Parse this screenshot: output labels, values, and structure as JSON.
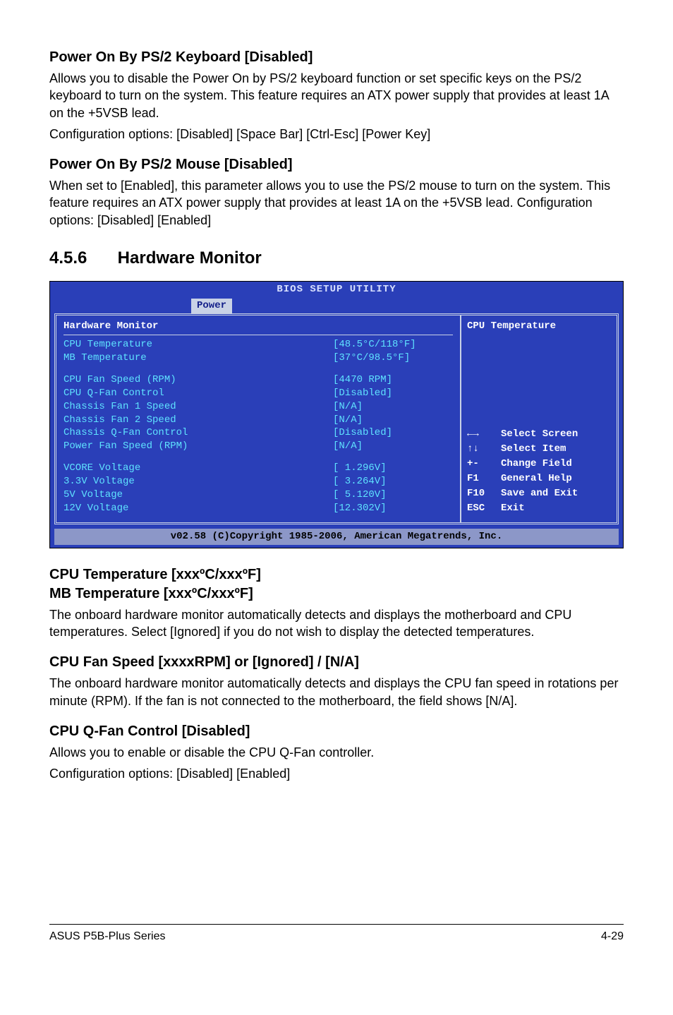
{
  "sections": {
    "kb_title": "Power On By PS/2 Keyboard [Disabled]",
    "kb_body1": "Allows you to disable the Power On by PS/2 keyboard function or set specific keys on the PS/2 keyboard to turn on the system. This feature requires an ATX power supply that provides at least 1A on the +5VSB lead.",
    "kb_body2": "Configuration options: [Disabled] [Space Bar] [Ctrl-Esc] [Power Key]",
    "mouse_title": "Power On By PS/2 Mouse [Disabled]",
    "mouse_body": "When set to [Enabled], this parameter allows you to use the PS/2 mouse to turn on the system. This feature requires an ATX power supply that provides at least 1A on the +5VSB lead. Configuration options: [Disabled] [Enabled]",
    "hw_num": "4.5.6",
    "hw_title": "Hardware Monitor",
    "temp_title": "CPU Temperature [xxxºC/xxxºF]\nMB Temperature [xxxºC/xxxºF]",
    "temp_body": "The onboard hardware monitor automatically detects and displays the motherboard and CPU temperatures. Select [Ignored] if you do not wish to display the detected temperatures.",
    "fan_title": "CPU Fan Speed [xxxxRPM] or [Ignored] / [N/A]",
    "fan_body": "The onboard hardware monitor automatically detects and displays the CPU fan speed in rotations per minute (RPM). If the fan is not connected to the motherboard, the field shows [N/A].",
    "qfan_title": "CPU Q-Fan Control [Disabled]",
    "qfan_body1": "Allows you to enable or disable the CPU Q-Fan controller.",
    "qfan_body2": "Configuration options: [Disabled] [Enabled]"
  },
  "bios": {
    "title": "BIOS SETUP UTILITY",
    "tab": "Power",
    "panel_title": "Hardware Monitor",
    "rows": [
      {
        "label": "CPU Temperature",
        "value": "[48.5°C/118°F]"
      },
      {
        "label": "MB Temperature",
        "value": "[37°C/98.5°F]"
      }
    ],
    "rows2": [
      {
        "label": "CPU Fan Speed (RPM)",
        "value": "[4470 RPM]"
      },
      {
        "label": "CPU Q-Fan Control",
        "value": "[Disabled]"
      },
      {
        "label": "Chassis Fan 1 Speed",
        "value": "[N/A]"
      },
      {
        "label": "Chassis Fan 2 Speed",
        "value": "[N/A]"
      },
      {
        "label": "Chassis Q-Fan Control",
        "value": "[Disabled]"
      },
      {
        "label": "Power Fan Speed (RPM)",
        "value": "[N/A]"
      }
    ],
    "rows3": [
      {
        "label": "VCORE Voltage",
        "value": "[ 1.296V]"
      },
      {
        "label": "3.3V Voltage",
        "value": "[ 3.264V]"
      },
      {
        "label": "5V Voltage",
        "value": "[ 5.120V]"
      },
      {
        "label": "12V Voltage",
        "value": "[12.302V]"
      }
    ],
    "help_title": "CPU Temperature",
    "keys": [
      {
        "key_class": "arrow-lr",
        "key": "",
        "desc": "Select Screen"
      },
      {
        "key_class": "arrow-ud",
        "key": "",
        "desc": "Select Item"
      },
      {
        "key_class": "",
        "key": "+-",
        "desc": "Change Field"
      },
      {
        "key_class": "",
        "key": "F1",
        "desc": "General Help"
      },
      {
        "key_class": "",
        "key": "F10",
        "desc": "Save and Exit"
      },
      {
        "key_class": "",
        "key": "ESC",
        "desc": "Exit"
      }
    ],
    "footer": "v02.58 (C)Copyright 1985-2006, American Megatrends, Inc."
  },
  "footer": {
    "left": "ASUS P5B-Plus Series",
    "right": "4-29"
  }
}
